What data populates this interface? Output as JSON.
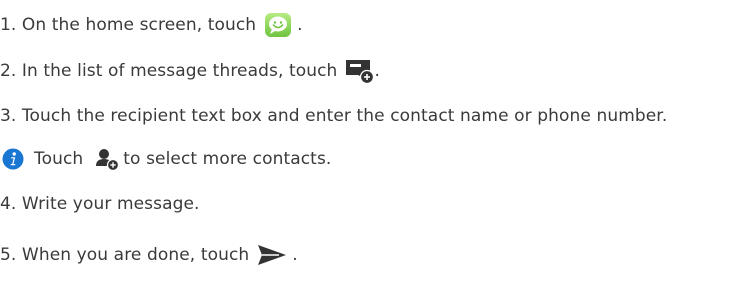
{
  "steps": {
    "s1": {
      "before": "1. On the home screen, touch",
      "after": ".",
      "icon": "messaging-app-icon"
    },
    "s2": {
      "before": "2. In the list of message threads, touch",
      "after": ".",
      "icon": "new-message-icon"
    },
    "s3": {
      "text": "3. Touch the recipient text box and enter the contact name or phone number."
    },
    "note": {
      "before": "Touch",
      "after": "to select more contacts.",
      "icon": "add-contact-icon",
      "badge_icon": "info-icon"
    },
    "s4": {
      "text": "4. Write your message."
    },
    "s5": {
      "before": "5. When you are done, touch",
      "after": ".",
      "icon": "send-icon"
    }
  },
  "colors": {
    "text": "#3a3a3a",
    "messaging_green": "#8bd35a",
    "info_blue": "#1976d2",
    "icon_dark": "#333333"
  }
}
